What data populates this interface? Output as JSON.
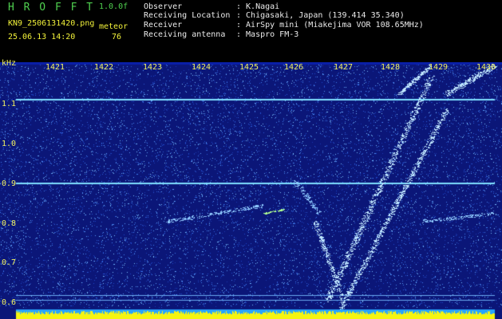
{
  "header": {
    "app_title": "H R O F F T",
    "version": "1.0.0f",
    "filename": "KN9_2506131420.png",
    "mode_label": "meteor",
    "datetime": "25.06.13 14:20",
    "count": "76",
    "info": [
      {
        "label": "Observer",
        "value": ": K.Nagai"
      },
      {
        "label": "Receiving Location",
        "value": ": Chigasaki, Japan (139.414 35.340)"
      },
      {
        "label": "Receiver",
        "value": ": AirSpy mini (Miakejima VOR 108.65MHz)"
      },
      {
        "label": "Receiving antenna",
        "value": ": Maspro FM-3"
      }
    ]
  },
  "spectrogram": {
    "y_unit": "kHz",
    "x_ticks": [
      "1421",
      "1422",
      "1423",
      "1424",
      "1425",
      "1426",
      "1427",
      "1428",
      "1429",
      "1430"
    ],
    "y_ticks": [
      "1.1",
      "1.0",
      "0.9",
      "0.8",
      "0.7",
      "0.6"
    ],
    "colors": {
      "background": "#0b1678",
      "trace": "#bfe6ff",
      "amplitude_bar": "#f5f510",
      "amplitude_bar_bg": "#26a4ff"
    }
  }
}
